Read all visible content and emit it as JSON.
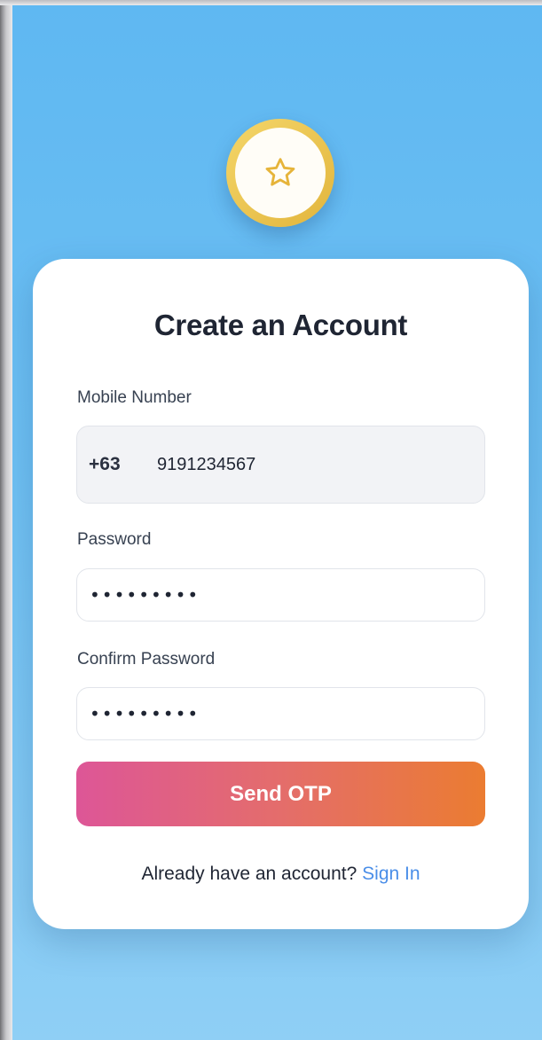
{
  "logo": {
    "icon": "star-icon",
    "ring_color": "#e8c04b",
    "star_color": "#e6b43a"
  },
  "form": {
    "title": "Create an Account",
    "mobile": {
      "label": "Mobile Number",
      "prefix": "+63",
      "value": "9191234567"
    },
    "password": {
      "label": "Password",
      "value_masked": "•••••••••"
    },
    "confirm_password": {
      "label": "Confirm Password",
      "value_masked": "•••••••••"
    },
    "submit_label": "Send OTP",
    "footer_text": "Already have an account?",
    "footer_link": "Sign In"
  },
  "colors": {
    "background_top": "#5fb8f2",
    "background_bottom": "#8fcff5",
    "button_gradient_start": "#dd5697",
    "button_gradient_end": "#eb7c31",
    "link": "#4a8ee8"
  }
}
